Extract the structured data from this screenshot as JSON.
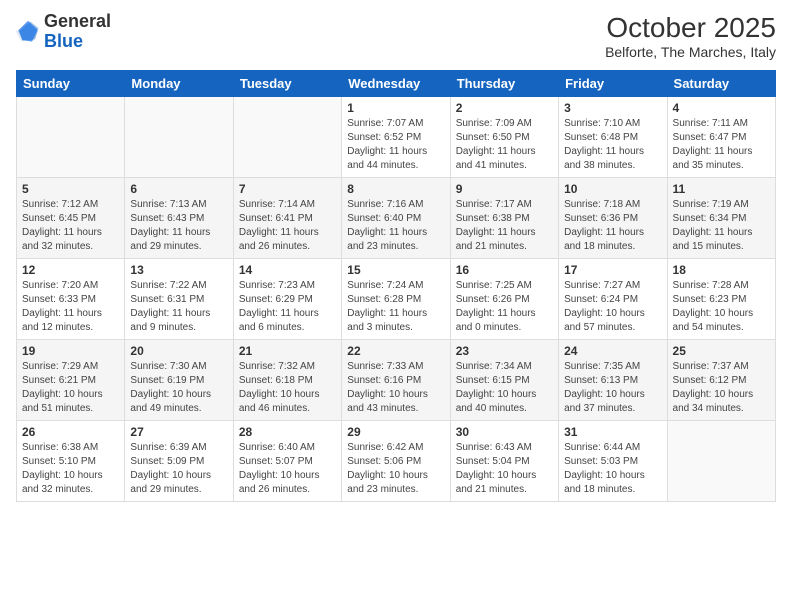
{
  "header": {
    "logo_general": "General",
    "logo_blue": "Blue",
    "month_title": "October 2025",
    "subtitle": "Belforte, The Marches, Italy"
  },
  "days_of_week": [
    "Sunday",
    "Monday",
    "Tuesday",
    "Wednesday",
    "Thursday",
    "Friday",
    "Saturday"
  ],
  "weeks": [
    [
      {
        "day": "",
        "info": ""
      },
      {
        "day": "",
        "info": ""
      },
      {
        "day": "",
        "info": ""
      },
      {
        "day": "1",
        "info": "Sunrise: 7:07 AM\nSunset: 6:52 PM\nDaylight: 11 hours and 44 minutes."
      },
      {
        "day": "2",
        "info": "Sunrise: 7:09 AM\nSunset: 6:50 PM\nDaylight: 11 hours and 41 minutes."
      },
      {
        "day": "3",
        "info": "Sunrise: 7:10 AM\nSunset: 6:48 PM\nDaylight: 11 hours and 38 minutes."
      },
      {
        "day": "4",
        "info": "Sunrise: 7:11 AM\nSunset: 6:47 PM\nDaylight: 11 hours and 35 minutes."
      }
    ],
    [
      {
        "day": "5",
        "info": "Sunrise: 7:12 AM\nSunset: 6:45 PM\nDaylight: 11 hours and 32 minutes."
      },
      {
        "day": "6",
        "info": "Sunrise: 7:13 AM\nSunset: 6:43 PM\nDaylight: 11 hours and 29 minutes."
      },
      {
        "day": "7",
        "info": "Sunrise: 7:14 AM\nSunset: 6:41 PM\nDaylight: 11 hours and 26 minutes."
      },
      {
        "day": "8",
        "info": "Sunrise: 7:16 AM\nSunset: 6:40 PM\nDaylight: 11 hours and 23 minutes."
      },
      {
        "day": "9",
        "info": "Sunrise: 7:17 AM\nSunset: 6:38 PM\nDaylight: 11 hours and 21 minutes."
      },
      {
        "day": "10",
        "info": "Sunrise: 7:18 AM\nSunset: 6:36 PM\nDaylight: 11 hours and 18 minutes."
      },
      {
        "day": "11",
        "info": "Sunrise: 7:19 AM\nSunset: 6:34 PM\nDaylight: 11 hours and 15 minutes."
      }
    ],
    [
      {
        "day": "12",
        "info": "Sunrise: 7:20 AM\nSunset: 6:33 PM\nDaylight: 11 hours and 12 minutes."
      },
      {
        "day": "13",
        "info": "Sunrise: 7:22 AM\nSunset: 6:31 PM\nDaylight: 11 hours and 9 minutes."
      },
      {
        "day": "14",
        "info": "Sunrise: 7:23 AM\nSunset: 6:29 PM\nDaylight: 11 hours and 6 minutes."
      },
      {
        "day": "15",
        "info": "Sunrise: 7:24 AM\nSunset: 6:28 PM\nDaylight: 11 hours and 3 minutes."
      },
      {
        "day": "16",
        "info": "Sunrise: 7:25 AM\nSunset: 6:26 PM\nDaylight: 11 hours and 0 minutes."
      },
      {
        "day": "17",
        "info": "Sunrise: 7:27 AM\nSunset: 6:24 PM\nDaylight: 10 hours and 57 minutes."
      },
      {
        "day": "18",
        "info": "Sunrise: 7:28 AM\nSunset: 6:23 PM\nDaylight: 10 hours and 54 minutes."
      }
    ],
    [
      {
        "day": "19",
        "info": "Sunrise: 7:29 AM\nSunset: 6:21 PM\nDaylight: 10 hours and 51 minutes."
      },
      {
        "day": "20",
        "info": "Sunrise: 7:30 AM\nSunset: 6:19 PM\nDaylight: 10 hours and 49 minutes."
      },
      {
        "day": "21",
        "info": "Sunrise: 7:32 AM\nSunset: 6:18 PM\nDaylight: 10 hours and 46 minutes."
      },
      {
        "day": "22",
        "info": "Sunrise: 7:33 AM\nSunset: 6:16 PM\nDaylight: 10 hours and 43 minutes."
      },
      {
        "day": "23",
        "info": "Sunrise: 7:34 AM\nSunset: 6:15 PM\nDaylight: 10 hours and 40 minutes."
      },
      {
        "day": "24",
        "info": "Sunrise: 7:35 AM\nSunset: 6:13 PM\nDaylight: 10 hours and 37 minutes."
      },
      {
        "day": "25",
        "info": "Sunrise: 7:37 AM\nSunset: 6:12 PM\nDaylight: 10 hours and 34 minutes."
      }
    ],
    [
      {
        "day": "26",
        "info": "Sunrise: 6:38 AM\nSunset: 5:10 PM\nDaylight: 10 hours and 32 minutes."
      },
      {
        "day": "27",
        "info": "Sunrise: 6:39 AM\nSunset: 5:09 PM\nDaylight: 10 hours and 29 minutes."
      },
      {
        "day": "28",
        "info": "Sunrise: 6:40 AM\nSunset: 5:07 PM\nDaylight: 10 hours and 26 minutes."
      },
      {
        "day": "29",
        "info": "Sunrise: 6:42 AM\nSunset: 5:06 PM\nDaylight: 10 hours and 23 minutes."
      },
      {
        "day": "30",
        "info": "Sunrise: 6:43 AM\nSunset: 5:04 PM\nDaylight: 10 hours and 21 minutes."
      },
      {
        "day": "31",
        "info": "Sunrise: 6:44 AM\nSunset: 5:03 PM\nDaylight: 10 hours and 18 minutes."
      },
      {
        "day": "",
        "info": ""
      }
    ]
  ]
}
